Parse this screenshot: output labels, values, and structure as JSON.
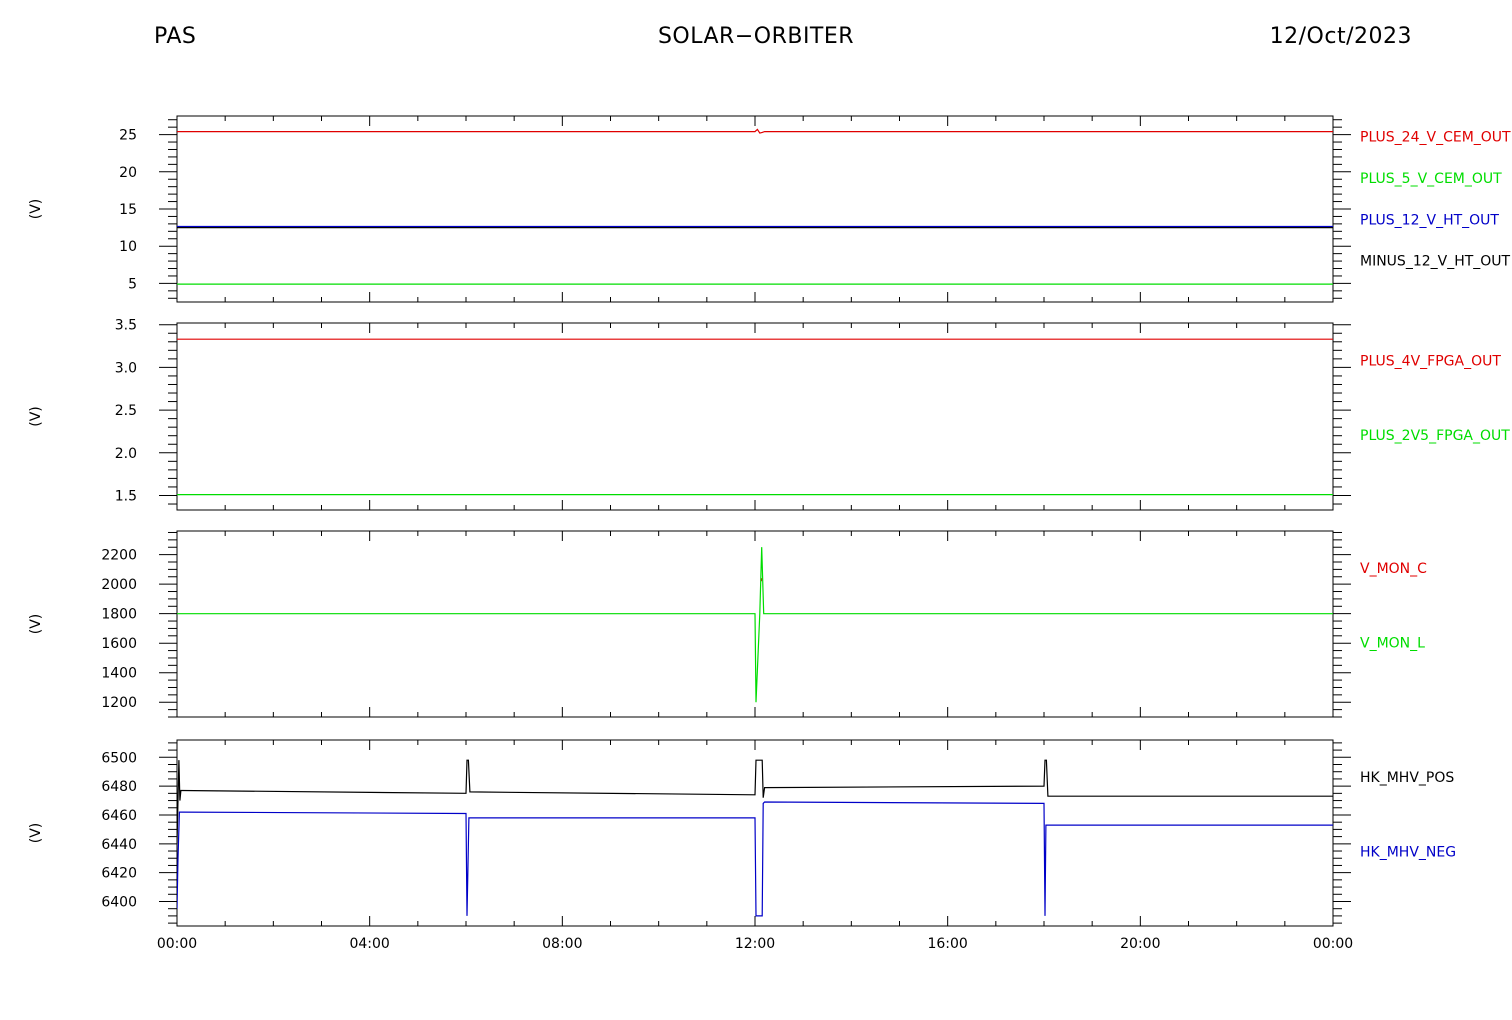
{
  "header": {
    "left": "PAS",
    "center": "SOLAR−ORBITER",
    "right": "12/Oct/2023"
  },
  "chart_data": [
    {
      "type": "line",
      "ylabel": "(V)",
      "ylim": [
        2.5,
        27.5
      ],
      "yticks": [
        5,
        10,
        15,
        20,
        25
      ],
      "ytick_labels": [
        "5",
        "10",
        "15",
        "20",
        "25"
      ],
      "minor_step": 1,
      "series": [
        {
          "name": "PLUS_24_V_CEM_OUT",
          "color": "#e00000",
          "x": [
            0,
            12.0,
            12.05,
            12.1,
            12.15,
            12.2,
            24
          ],
          "y": [
            25.4,
            25.4,
            25.7,
            25.2,
            25.3,
            25.4,
            25.4
          ]
        },
        {
          "name": "PLUS_5_V_CEM_OUT",
          "color": "#00dd00",
          "x": [
            0,
            24
          ],
          "y": [
            4.9,
            4.9
          ]
        },
        {
          "name": "PLUS_12_V_HT_OUT",
          "color": "#0000c8",
          "x": [
            0,
            24
          ],
          "y": [
            12.6,
            12.6
          ]
        },
        {
          "name": "MINUS_12_V_HT_OUT",
          "color": "#000000",
          "x": [
            0,
            24
          ],
          "y": [
            12.5,
            12.5
          ]
        }
      ]
    },
    {
      "type": "line",
      "ylabel": "(V)",
      "ylim": [
        1.33,
        3.52
      ],
      "yticks": [
        1.5,
        2.0,
        2.5,
        3.0,
        3.5
      ],
      "ytick_labels": [
        "1.5",
        "2.0",
        "2.5",
        "3.0",
        "3.5"
      ],
      "minor_step": 0.1,
      "series": [
        {
          "name": "PLUS_4V_FPGA_OUT",
          "color": "#e00000",
          "x": [
            0,
            24
          ],
          "y": [
            3.33,
            3.33
          ]
        },
        {
          "name": "PLUS_2V5_FPGA_OUT",
          "color": "#00dd00",
          "x": [
            0,
            24
          ],
          "y": [
            1.51,
            1.51
          ]
        }
      ]
    },
    {
      "type": "line",
      "ylabel": "(V)",
      "ylim": [
        1100,
        2360
      ],
      "yticks": [
        1200,
        1400,
        1600,
        1800,
        2000,
        2200
      ],
      "ytick_labels": [
        "1200",
        "1400",
        "1600",
        "1800",
        "2000",
        "2200"
      ],
      "minor_step": 50,
      "series": [
        {
          "name": "V_MON_C",
          "color": "#e00000",
          "x": [
            12.13,
            12.14
          ],
          "y": [
            2020,
            2040
          ]
        },
        {
          "name": "V_MON_L",
          "color": "#00dd00",
          "x": [
            0,
            12.0,
            12.02,
            12.06,
            12.1,
            12.14,
            12.18,
            12.2,
            24
          ],
          "y": [
            1800,
            1800,
            1200,
            1500,
            1800,
            2250,
            1800,
            1800,
            1800
          ]
        }
      ]
    },
    {
      "type": "line",
      "ylabel": "(V)",
      "ylim": [
        6383,
        6512
      ],
      "yticks": [
        6400,
        6420,
        6440,
        6460,
        6480,
        6500
      ],
      "ytick_labels": [
        "6400",
        "6420",
        "6440",
        "6460",
        "6480",
        "6500"
      ],
      "minor_step": 5,
      "series": [
        {
          "name": "HK_MHV_POS",
          "color": "#000000",
          "x": [
            0,
            0.04,
            0.06,
            0.08,
            0.1,
            6.0,
            6.02,
            6.05,
            6.08,
            12.0,
            12.02,
            12.15,
            12.17,
            12.2,
            18.0,
            18.02,
            18.05,
            18.08,
            24
          ],
          "y": [
            6440,
            6498,
            6470,
            6477,
            6477,
            6475,
            6498,
            6498,
            6476,
            6474,
            6498,
            6498,
            6472,
            6479,
            6480,
            6498,
            6498,
            6473,
            6473
          ]
        },
        {
          "name": "HK_MHV_NEG",
          "color": "#0000c8",
          "x": [
            0,
            0.02,
            0.05,
            0.1,
            6.0,
            6.02,
            6.06,
            6.1,
            12.0,
            12.02,
            12.04,
            12.15,
            12.17,
            12.2,
            18.0,
            18.02,
            18.04,
            18.06,
            24
          ],
          "y": [
            6395,
            6430,
            6462,
            6462,
            6461,
            6390,
            6458,
            6458,
            6458,
            6390,
            6390,
            6390,
            6468,
            6469,
            6468,
            6390,
            6453,
            6453,
            6453
          ]
        }
      ]
    }
  ],
  "x_axis": {
    "range": [
      0,
      24
    ],
    "ticks": [
      0,
      4,
      8,
      12,
      16,
      20,
      24
    ],
    "tick_labels": [
      "00:00",
      "04:00",
      "08:00",
      "12:00",
      "16:00",
      "20:00",
      "00:00"
    ]
  }
}
